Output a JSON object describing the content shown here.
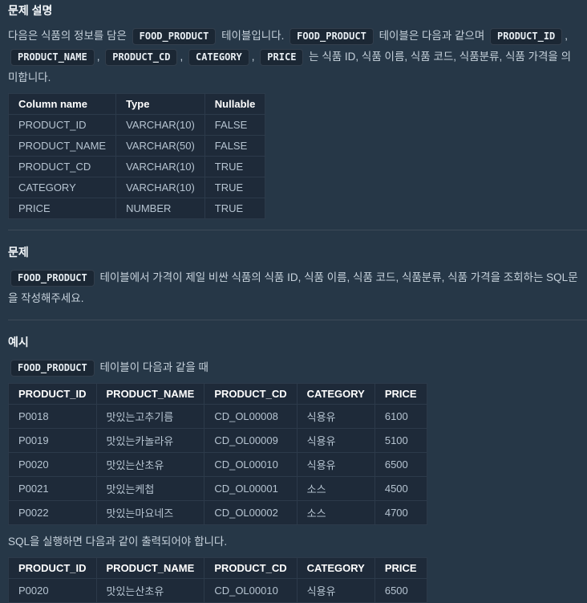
{
  "colors": {
    "page_background": "#263747",
    "table_background": "#1e2a39",
    "table_border": "#2c3a4a",
    "chip_background": "#1b2734",
    "heading_text": "#f3f7fa",
    "body_text": "#c7d2dc",
    "cell_text": "#b6c4d1",
    "header_text": "#ffffff"
  },
  "sections": {
    "description": {
      "title": "문제 설명",
      "paragraph": [
        {
          "t": "text",
          "v": "다음은 식품의 정보를 담은 "
        },
        {
          "t": "code",
          "v": "FOOD_PRODUCT"
        },
        {
          "t": "text",
          "v": " 테이블입니다. "
        },
        {
          "t": "code",
          "v": "FOOD_PRODUCT"
        },
        {
          "t": "text",
          "v": " 테이블은 다음과 같으며 "
        },
        {
          "t": "code",
          "v": "PRODUCT_ID"
        },
        {
          "t": "text",
          "v": ", "
        },
        {
          "t": "code",
          "v": "PRODUCT_NAME"
        },
        {
          "t": "text",
          "v": ", "
        },
        {
          "t": "code",
          "v": "PRODUCT_CD"
        },
        {
          "t": "text",
          "v": ", "
        },
        {
          "t": "code",
          "v": "CATEGORY"
        },
        {
          "t": "text",
          "v": ", "
        },
        {
          "t": "code",
          "v": "PRICE"
        },
        {
          "t": "text",
          "v": " 는 식품 ID, 식품 이름, 식품 코드, 식품분류, 식품 가격을 의미합니다."
        }
      ],
      "schema_table": {
        "headers": [
          "Column name",
          "Type",
          "Nullable"
        ],
        "rows": [
          [
            "PRODUCT_ID",
            "VARCHAR(10)",
            "FALSE"
          ],
          [
            "PRODUCT_NAME",
            "VARCHAR(50)",
            "FALSE"
          ],
          [
            "PRODUCT_CD",
            "VARCHAR(10)",
            "TRUE"
          ],
          [
            "CATEGORY",
            "VARCHAR(10)",
            "TRUE"
          ],
          [
            "PRICE",
            "NUMBER",
            "TRUE"
          ]
        ]
      }
    },
    "problem": {
      "title": "문제",
      "paragraph": [
        {
          "t": "code",
          "v": "FOOD_PRODUCT"
        },
        {
          "t": "text",
          "v": " 테이블에서 가격이 제일 비싼 식품의 식품 ID, 식품 이름, 식품 코드, 식품분류, 식품 가격을 조회하는 SQL문을 작성해주세요."
        }
      ]
    },
    "example": {
      "title": "예시",
      "intro": [
        {
          "t": "code",
          "v": "FOOD_PRODUCT"
        },
        {
          "t": "text",
          "v": " 테이블이 다음과 같을 때"
        }
      ],
      "input_table": {
        "headers": [
          "PRODUCT_ID",
          "PRODUCT_NAME",
          "PRODUCT_CD",
          "CATEGORY",
          "PRICE"
        ],
        "rows": [
          [
            "P0018",
            "맛있는고추기름",
            "CD_OL00008",
            "식용유",
            "6100"
          ],
          [
            "P0019",
            "맛있는카놀라유",
            "CD_OL00009",
            "식용유",
            "5100"
          ],
          [
            "P0020",
            "맛있는산초유",
            "CD_OL00010",
            "식용유",
            "6500"
          ],
          [
            "P0021",
            "맛있는케첩",
            "CD_OL00001",
            "소스",
            "4500"
          ],
          [
            "P0022",
            "맛있는마요네즈",
            "CD_OL00002",
            "소스",
            "4700"
          ]
        ]
      },
      "output_intro": "SQL을 실행하면 다음과 같이 출력되어야 합니다.",
      "output_table": {
        "headers": [
          "PRODUCT_ID",
          "PRODUCT_NAME",
          "PRODUCT_CD",
          "CATEGORY",
          "PRICE"
        ],
        "rows": [
          [
            "P0020",
            "맛있는산초유",
            "CD_OL00010",
            "식용유",
            "6500"
          ]
        ]
      }
    }
  }
}
